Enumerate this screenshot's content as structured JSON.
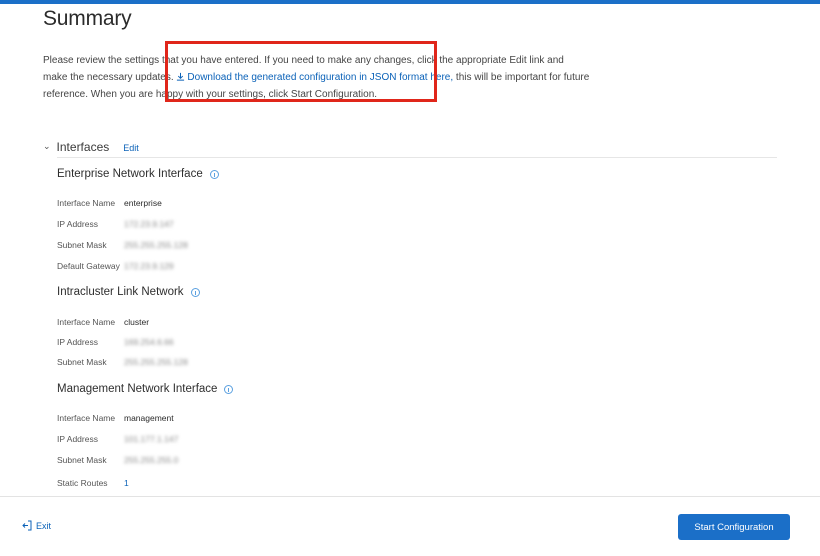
{
  "page": {
    "title": "Summary"
  },
  "intro": {
    "line1": "Please review the settings that you have entered. If you need to make any changes, click the appropriate Edit link and",
    "line2_pre": "make the necessary updates.",
    "download_link": "Download the generated configuration in JSON format here,",
    "line2_post": " this will be important for future",
    "line3": "reference. When you are happy with your settings, click Start Configuration."
  },
  "interfaces": {
    "section_title": "Interfaces",
    "edit_label": "Edit",
    "enterprise": {
      "title": "Enterprise Network Interface",
      "rows": [
        {
          "label": "Interface Name",
          "value": "enterprise"
        },
        {
          "label": "IP Address",
          "value": "172.23.9.147"
        },
        {
          "label": "Subnet Mask",
          "value": "255.255.255.128"
        },
        {
          "label": "Default Gateway",
          "value": "172.23.9.129"
        }
      ]
    },
    "intracluster": {
      "title": "Intracluster Link Network",
      "rows": [
        {
          "label": "Interface Name",
          "value": "cluster"
        },
        {
          "label": "IP Address",
          "value": "169.254.6.66"
        },
        {
          "label": "Subnet Mask",
          "value": "255.255.255.128"
        }
      ]
    },
    "management": {
      "title": "Management Network Interface",
      "rows": [
        {
          "label": "Interface Name",
          "value": "management"
        },
        {
          "label": "IP Address",
          "value": "101.177.1.147"
        },
        {
          "label": "Subnet Mask",
          "value": "255.255.255.0"
        },
        {
          "label": "Static Routes",
          "value": "1"
        }
      ]
    }
  },
  "footer": {
    "exit_label": "Exit",
    "start_label": "Start Configuration"
  },
  "colors": {
    "accent": "#1b6fc8",
    "link": "#0b62b8",
    "highlight_box": "#e0261a"
  }
}
